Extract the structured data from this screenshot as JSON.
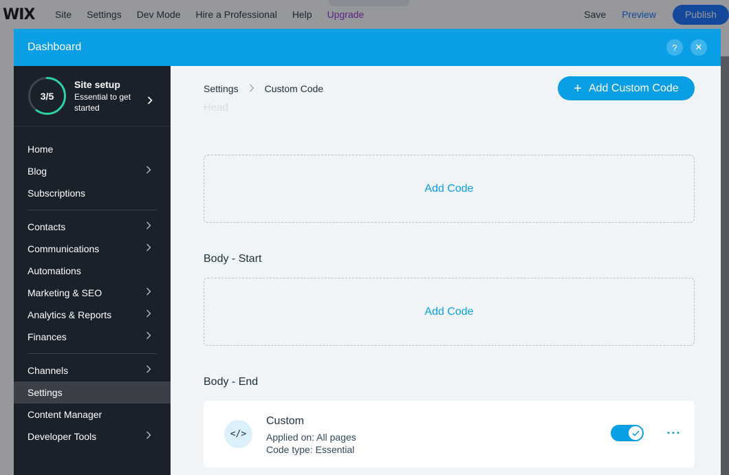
{
  "editor": {
    "logo": "WIX",
    "nav": [
      "Site",
      "Settings",
      "Dev Mode",
      "Hire a Professional",
      "Help",
      "Upgrade"
    ],
    "save_label": "Save",
    "preview_label": "Preview",
    "publish_label": "Publish"
  },
  "dashboard": {
    "title": "Dashboard",
    "help_glyph": "?",
    "close_glyph": "✕"
  },
  "sidebar": {
    "setup": {
      "progress_text": "3/5",
      "progress_fraction": 0.6,
      "title": "Site setup",
      "subtitle": "Essential to get started"
    },
    "groups": [
      [
        {
          "label": "Home",
          "chevron": false
        },
        {
          "label": "Blog",
          "chevron": true
        },
        {
          "label": "Subscriptions",
          "chevron": false
        }
      ],
      [
        {
          "label": "Contacts",
          "chevron": true
        },
        {
          "label": "Communications",
          "chevron": true
        },
        {
          "label": "Automations",
          "chevron": false
        },
        {
          "label": "Marketing & SEO",
          "chevron": true
        },
        {
          "label": "Analytics & Reports",
          "chevron": true
        },
        {
          "label": "Finances",
          "chevron": true
        }
      ],
      [
        {
          "label": "Channels",
          "chevron": true
        },
        {
          "label": "Settings",
          "chevron": false,
          "active": true
        },
        {
          "label": "Content Manager",
          "chevron": false
        },
        {
          "label": "Developer Tools",
          "chevron": true
        }
      ]
    ]
  },
  "main": {
    "breadcrumb": {
      "parent": "Settings",
      "current": "Custom Code"
    },
    "add_custom_code_label": "Add Custom Code",
    "sections": {
      "head_label": "Head",
      "body_start_label": "Body - Start",
      "body_end_label": "Body - End",
      "add_code_label": "Add Code"
    },
    "code_item": {
      "name": "Custom",
      "applied_on": "Applied on: All pages",
      "code_type": "Code type: Essential",
      "icon_glyph": "</>",
      "enabled": true
    }
  },
  "colors": {
    "accent": "#0a9fe4",
    "sidebar_bg": "#1b212a",
    "progress": "#2ed1a2",
    "upgrade": "#9a27d5"
  }
}
